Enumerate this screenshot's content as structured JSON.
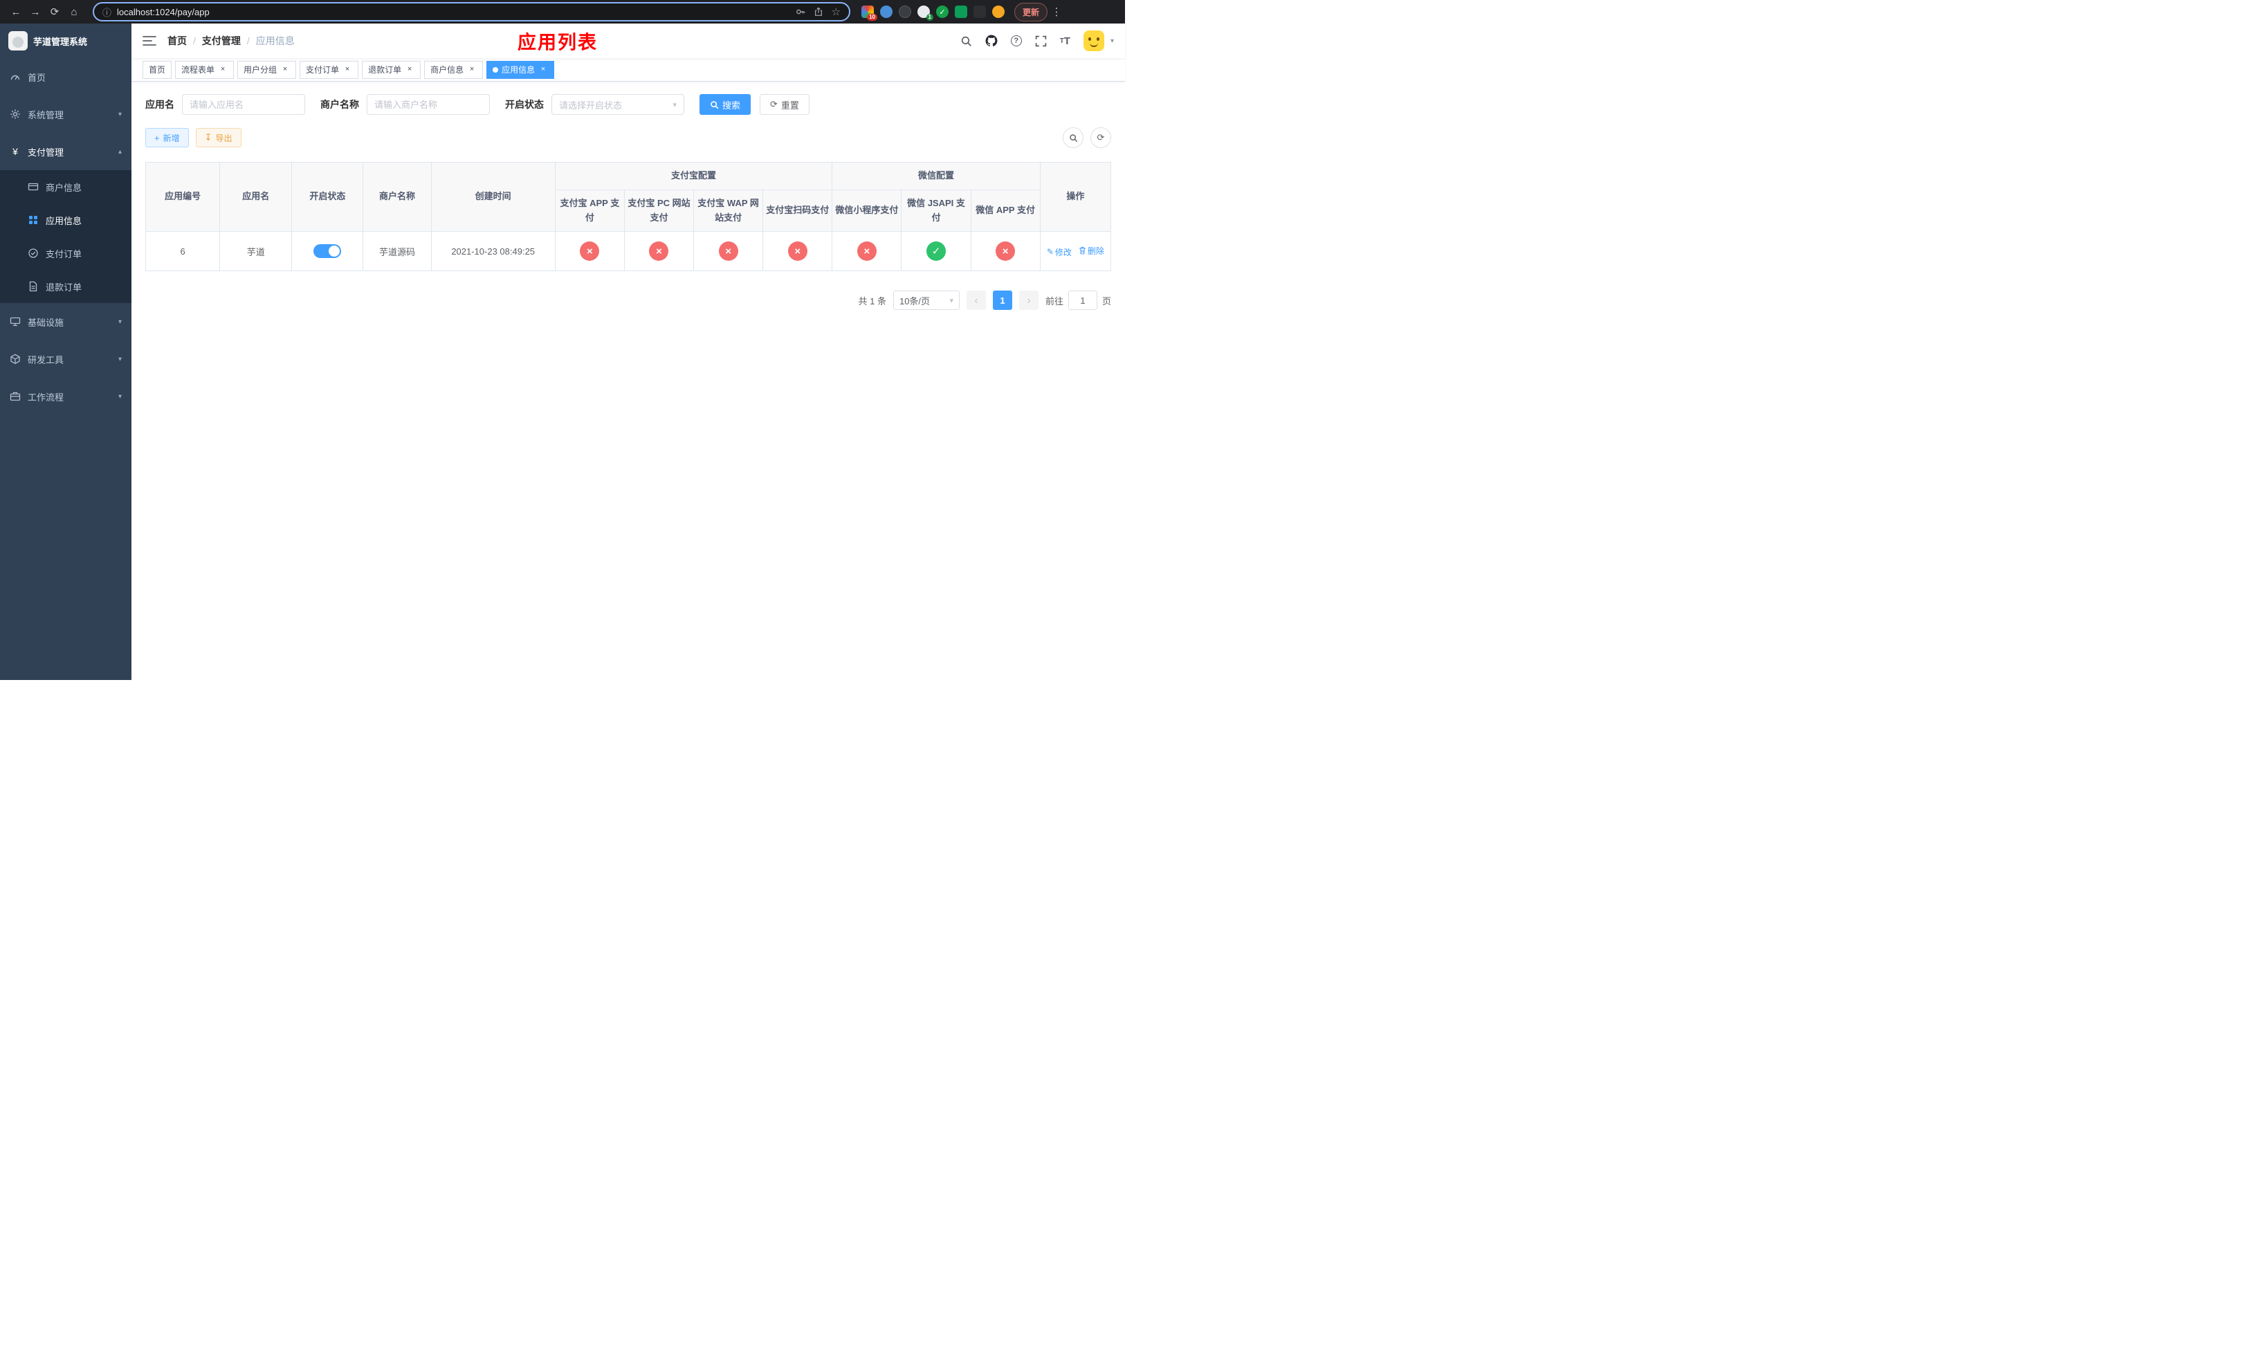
{
  "browser": {
    "url": "localhost:1024/pay/app",
    "update_label": "更新",
    "ext_badge_puzzle": "10",
    "ext_badge_green": "1"
  },
  "icons": {
    "back": "←",
    "forward": "→",
    "reload": "⟳",
    "home": "⌂",
    "info": "ⓘ",
    "star": "☆",
    "kebab": "⋮",
    "cross": "×",
    "check": "✓",
    "chev_down": "▾",
    "chev_up": "▴",
    "arrow_left": "‹",
    "arrow_right": "›",
    "plus": "+",
    "download": "↧",
    "yen": "¥",
    "edit": "✎",
    "refresh": "⟳",
    "caret": "▾"
  },
  "sidebar": {
    "logo_title": "芋道管理系统",
    "items": [
      {
        "label": "首页"
      },
      {
        "label": "系统管理"
      },
      {
        "label": "支付管理"
      },
      {
        "label": "商户信息"
      },
      {
        "label": "应用信息"
      },
      {
        "label": "支付订单"
      },
      {
        "label": "退款订单"
      },
      {
        "label": "基础设施"
      },
      {
        "label": "研发工具"
      },
      {
        "label": "工作流程"
      }
    ]
  },
  "header": {
    "breadcrumb": {
      "items": [
        "首页",
        "支付管理",
        "应用信息"
      ],
      "separator": "/"
    },
    "page_title": "应用列表",
    "fontsize_glyph": "T"
  },
  "tabs": [
    {
      "label": "首页",
      "closable": false,
      "active": false
    },
    {
      "label": "流程表单",
      "closable": true,
      "active": false
    },
    {
      "label": "用户分组",
      "closable": true,
      "active": false
    },
    {
      "label": "支付订单",
      "closable": true,
      "active": false
    },
    {
      "label": "退款订单",
      "closable": true,
      "active": false
    },
    {
      "label": "商户信息",
      "closable": true,
      "active": false
    },
    {
      "label": "应用信息",
      "closable": true,
      "active": true
    }
  ],
  "filters": {
    "app_name_label": "应用名",
    "app_name_placeholder": "请输入应用名",
    "merchant_label": "商户名称",
    "merchant_placeholder": "请输入商户名称",
    "status_label": "开启状态",
    "status_placeholder": "请选择开启状态",
    "search_label": "搜索",
    "reset_label": "重置"
  },
  "toolbar": {
    "add_label": "新增",
    "export_label": "导出"
  },
  "table": {
    "headers": {
      "app_id": "应用编号",
      "app_name": "应用名",
      "status": "开启状态",
      "merchant": "商户名称",
      "created": "创建时间",
      "alipay_group": "支付宝配置",
      "wechat_group": "微信配置",
      "alipay_app": "支付宝 APP 支付",
      "alipay_pc": "支付宝 PC 网站支付",
      "alipay_wap": "支付宝 WAP 网站支付",
      "alipay_qr": "支付宝扫码支付",
      "wx_mini": "微信小程序支付",
      "wx_jsapi": "微信 JSAPI 支付",
      "wx_app": "微信 APP 支付",
      "actions": "操作"
    },
    "row": {
      "id": "6",
      "app_name": "芋道",
      "status_on": true,
      "merchant": "芋道源码",
      "created": "2021-10-23 08:49:25",
      "configs": {
        "alipay_app": false,
        "alipay_pc": false,
        "alipay_wap": false,
        "alipay_qr": false,
        "wx_mini": false,
        "wx_jsapi": true,
        "wx_app": false
      },
      "edit_label": "修改",
      "delete_label": "删除"
    }
  },
  "pagination": {
    "total_label": "共 1 条",
    "page_size_label": "10条/页",
    "current_page": "1",
    "goto_label": "前往",
    "goto_value": "1",
    "page_suffix": "页"
  },
  "colors": {
    "primary": "#409EFF",
    "danger": "#f56c6c",
    "success": "#2dc26b",
    "title_red": "#ff0000",
    "sidebar_bg": "#304156",
    "submenu_bg": "#1f2d3d"
  }
}
